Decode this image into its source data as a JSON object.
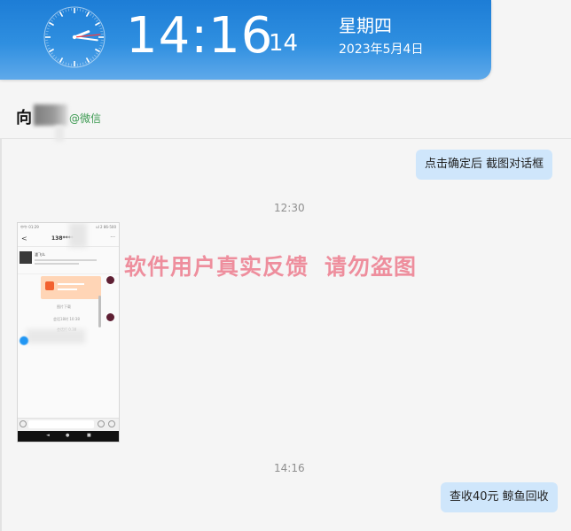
{
  "clock": {
    "time": "14:16",
    "seconds": "14",
    "weekday": "星期四",
    "date": "2023年5月4日",
    "analog": {
      "hour": 14,
      "minute": 16,
      "second": 14
    }
  },
  "header": {
    "contact_name_visible": "向",
    "source": "@微信"
  },
  "messages": {
    "m1": "点击确定后  截图对话框",
    "t1": "12:30",
    "t2": "14:16",
    "m2": "查收40元 鲸鱼回收"
  },
  "phone": {
    "status_left": "中午 01:29",
    "status_right": "ul 2 86-500",
    "back": "<",
    "name": "138****",
    "more": "···",
    "card_text": "瀘飞么",
    "gray_1": "图片下载",
    "gray_2": "会话18时 10:38",
    "gray_3": "会话打 0.38",
    "nav": [
      "◄",
      "●",
      "■"
    ]
  },
  "watermark": {
    "part1": "软件用户真实反馈",
    "part2": "请勿盗图"
  },
  "colors": {
    "banner": "#2f8fe0",
    "bubble": "#cfe6fb",
    "source_green": "#3d9a52",
    "watermark": "#ec667c"
  }
}
